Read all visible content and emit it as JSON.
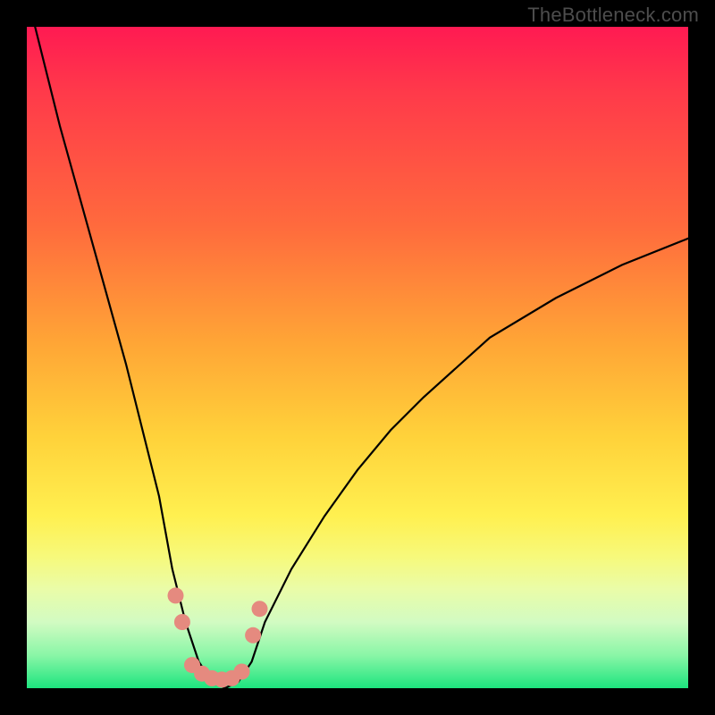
{
  "watermark": "TheBottleneck.com",
  "chart_data": {
    "type": "line",
    "title": "",
    "xlabel": "",
    "ylabel": "",
    "ylim": [
      0,
      100
    ],
    "series": [
      {
        "name": "bottleneck-curve",
        "x": [
          0,
          5,
          10,
          15,
          20,
          22,
          24,
          26,
          28,
          30,
          32,
          34,
          36,
          40,
          45,
          50,
          55,
          60,
          70,
          80,
          90,
          100
        ],
        "values": [
          105,
          85,
          67,
          49,
          29,
          18,
          10,
          4,
          1,
          0,
          1,
          4,
          10,
          18,
          26,
          33,
          39,
          44,
          53,
          59,
          64,
          68
        ]
      }
    ],
    "markers": {
      "name": "highlighted-dots",
      "color": "#e58a7f",
      "points": [
        {
          "x": 22.5,
          "y": 14
        },
        {
          "x": 23.5,
          "y": 10
        },
        {
          "x": 25.0,
          "y": 3.5
        },
        {
          "x": 26.5,
          "y": 2.2
        },
        {
          "x": 28.0,
          "y": 1.5
        },
        {
          "x": 29.5,
          "y": 1.3
        },
        {
          "x": 31.0,
          "y": 1.5
        },
        {
          "x": 32.5,
          "y": 2.5
        },
        {
          "x": 34.2,
          "y": 8
        },
        {
          "x": 35.2,
          "y": 12
        }
      ]
    },
    "background_gradient": {
      "stops": [
        {
          "pos": 0,
          "color": "#ff1a52"
        },
        {
          "pos": 30,
          "color": "#ff6a3d"
        },
        {
          "pos": 62,
          "color": "#ffd23a"
        },
        {
          "pos": 85,
          "color": "#eafca8"
        },
        {
          "pos": 100,
          "color": "#1de47e"
        }
      ]
    }
  }
}
